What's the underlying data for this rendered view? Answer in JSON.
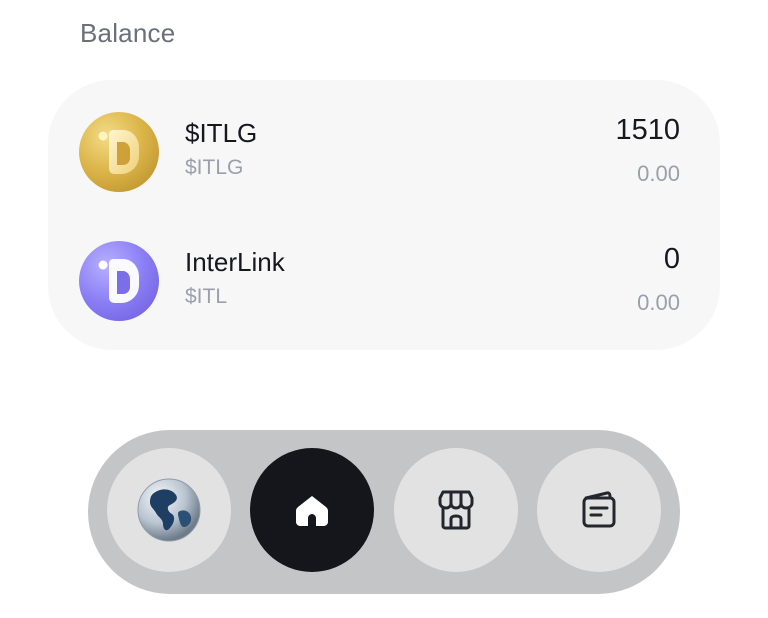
{
  "balance": {
    "title": "Balance",
    "tokens": [
      {
        "name": "$ITLG",
        "symbol": "$ITLG",
        "amount": "1510",
        "value": "0.00",
        "icon": "itlg-coin-icon",
        "color": "#d9b04a"
      },
      {
        "name": "InterLink",
        "symbol": "$ITL",
        "amount": "0",
        "value": "0.00",
        "icon": "interlink-coin-icon",
        "color": "#8a7df4"
      }
    ]
  },
  "nav": {
    "items": [
      {
        "icon": "globe-icon",
        "active": false
      },
      {
        "icon": "home-icon",
        "active": true
      },
      {
        "icon": "store-icon",
        "active": false
      },
      {
        "icon": "wallet-icon",
        "active": false
      }
    ]
  },
  "colors": {
    "card_bg": "#f7f7f8",
    "nav_bg": "#c4c5c7",
    "nav_button_bg": "#e2e2e3",
    "nav_active_bg": "#14161b"
  }
}
